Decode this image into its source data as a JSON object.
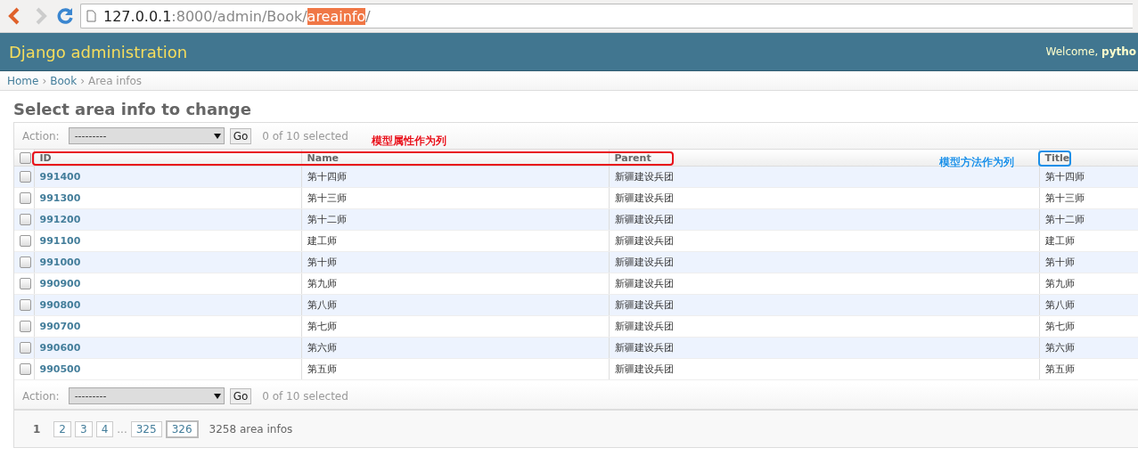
{
  "browser": {
    "back_enabled": true,
    "forward_enabled": false,
    "url_parts": [
      {
        "text": "127.0.0.1",
        "kind": "host"
      },
      {
        "text": ":8000/admin/Book/",
        "kind": "path"
      },
      {
        "text": "areainfo",
        "kind": "highlight"
      },
      {
        "text": "/",
        "kind": "path"
      }
    ]
  },
  "header": {
    "title": "Django administration",
    "welcome": "Welcome,",
    "user": "pytho"
  },
  "breadcrumbs": [
    {
      "text": "Home",
      "kind": "link"
    },
    {
      "text": "›",
      "kind": "separator"
    },
    {
      "text": "Book",
      "kind": "link"
    },
    {
      "text": "›",
      "kind": "separator"
    },
    {
      "text": "Area infos",
      "kind": "current"
    }
  ],
  "heading": "Select area info to change",
  "actions_top": {
    "label": "Action:",
    "value": "---------",
    "button": "Go",
    "counter": "0 of 10 selected"
  },
  "table": {
    "select_all_checked": false,
    "columns": [
      "ID",
      "Name",
      "Parent",
      "Title"
    ],
    "rows": [
      {
        "checked": false,
        "id": "991400",
        "name": "第十四师",
        "parent": "新疆建设兵团",
        "title": "第十四师"
      },
      {
        "checked": false,
        "id": "991300",
        "name": "第十三师",
        "parent": "新疆建设兵团",
        "title": "第十三师"
      },
      {
        "checked": false,
        "id": "991200",
        "name": "第十二师",
        "parent": "新疆建设兵团",
        "title": "第十二师"
      },
      {
        "checked": false,
        "id": "991100",
        "name": "建工师",
        "parent": "新疆建设兵团",
        "title": "建工师"
      },
      {
        "checked": false,
        "id": "991000",
        "name": "第十师",
        "parent": "新疆建设兵团",
        "title": "第十师"
      },
      {
        "checked": false,
        "id": "990900",
        "name": "第九师",
        "parent": "新疆建设兵团",
        "title": "第九师"
      },
      {
        "checked": false,
        "id": "990800",
        "name": "第八师",
        "parent": "新疆建设兵团",
        "title": "第八师"
      },
      {
        "checked": false,
        "id": "990700",
        "name": "第七师",
        "parent": "新疆建设兵团",
        "title": "第七师"
      },
      {
        "checked": false,
        "id": "990600",
        "name": "第六师",
        "parent": "新疆建设兵团",
        "title": "第六师"
      },
      {
        "checked": false,
        "id": "990500",
        "name": "第五师",
        "parent": "新疆建设兵团",
        "title": "第五师"
      }
    ]
  },
  "annotations": [
    {
      "text": "模型属性作为列",
      "color": "#e8101a"
    },
    {
      "text": "模型方法作为列",
      "color": "#1a8fe8"
    }
  ],
  "actions_bottom": {
    "label": "Action:",
    "value": "---------",
    "button": "Go",
    "counter": "0 of 10 selected"
  },
  "pagination": {
    "pages": [
      {
        "text": "1",
        "kind": "page",
        "selected": true
      },
      {
        "text": "2",
        "kind": "page",
        "selected": false
      },
      {
        "text": "3",
        "kind": "page",
        "selected": false
      },
      {
        "text": "4",
        "kind": "page",
        "selected": false
      },
      {
        "text": "...",
        "kind": "ellipsis"
      },
      {
        "text": "325",
        "kind": "page",
        "selected": false
      },
      {
        "text": "326",
        "kind": "end",
        "selected": false
      }
    ],
    "count": "3258 area infos"
  }
}
